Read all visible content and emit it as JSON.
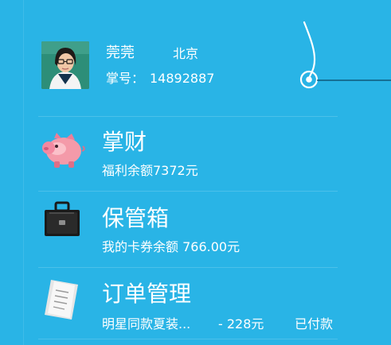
{
  "profile": {
    "name": "莞莞",
    "city": "北京",
    "account_label": "掌号：",
    "account_number": "14892887"
  },
  "menu": [
    {
      "id": "wealth",
      "icon": "piggy-bank-icon",
      "title": "掌财",
      "subtitle": "福利余额7372元"
    },
    {
      "id": "safe-box",
      "icon": "briefcase-icon",
      "title": "保管箱",
      "subtitle": "我的卡券余额 766.00元"
    },
    {
      "id": "orders",
      "icon": "receipt-icon",
      "title": "订单管理",
      "subtitle": "明星同款夏装...",
      "price": "- 228元",
      "status": "已付款"
    }
  ],
  "colors": {
    "background": "#29b4e6",
    "text": "#ffffff"
  }
}
